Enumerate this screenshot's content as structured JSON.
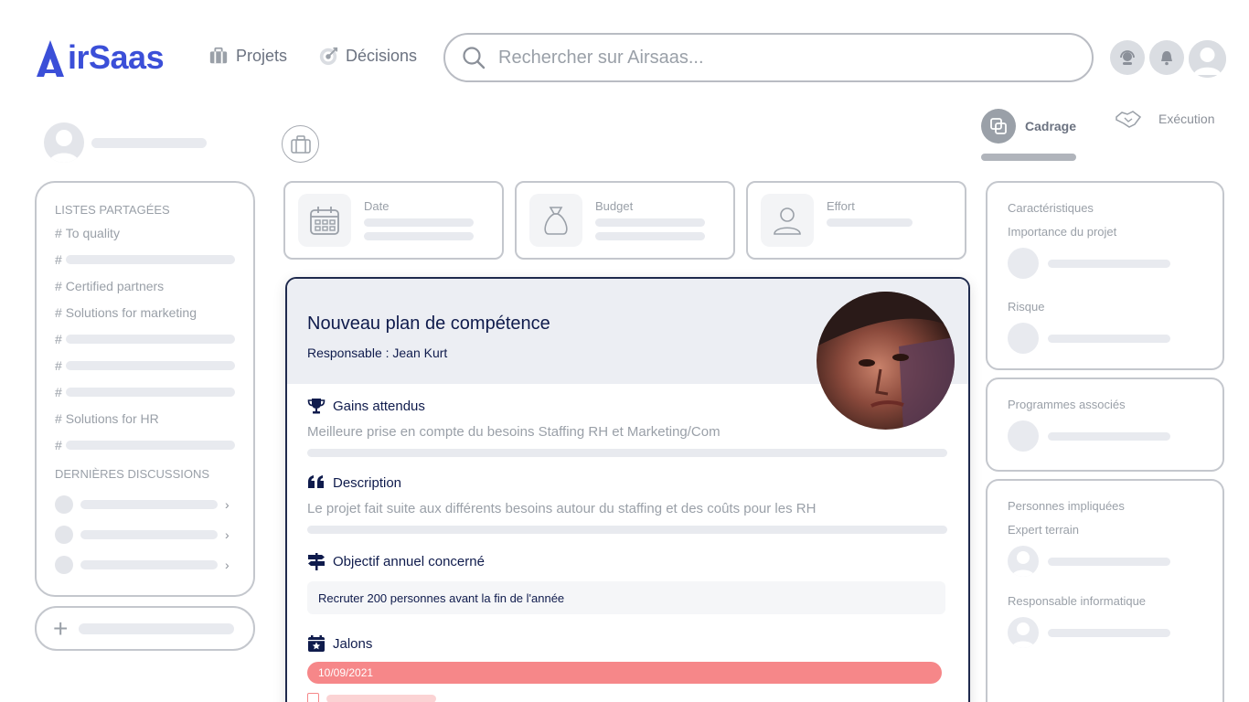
{
  "app": {
    "logo_text": "irSaas",
    "brand_color": "#3b4fd8"
  },
  "nav": {
    "projets": {
      "label": "Projets",
      "icon": "briefcase-icon"
    },
    "decisions": {
      "label": "Décisions",
      "icon": "target-icon"
    }
  },
  "search": {
    "placeholder": "Rechercher sur Airsaas..."
  },
  "sidebar": {
    "shared_lists_heading": "LISTES PARTAGÉES",
    "items": [
      {
        "hash": "#",
        "label": "To quality"
      },
      {
        "hash": "#",
        "label": ""
      },
      {
        "hash": "#",
        "label": "Certified partners"
      },
      {
        "hash": "#",
        "label": "Solutions for marketing"
      },
      {
        "hash": "#",
        "label": ""
      },
      {
        "hash": "#",
        "label": ""
      },
      {
        "hash": "#",
        "label": ""
      },
      {
        "hash": "#",
        "label": "Solutions for HR"
      },
      {
        "hash": "#",
        "label": ""
      }
    ],
    "discussions_heading": "DERNIÈRES DISCUSSIONS",
    "add_button": "+"
  },
  "metrics": {
    "date": "Date",
    "budget": "Budget",
    "effort": "Effort"
  },
  "project": {
    "title": "Nouveau plan de compétence",
    "responsable": "Responsable : Jean Kurt",
    "gains_title": "Gains attendus",
    "gains_text": "Meilleure prise en compte du besoins Staffing RH et Marketing/Com",
    "description_title": "Description",
    "description_text": "Le projet fait suite aux différents besoins autour du staffing et des coûts pour les RH",
    "objective_title": "Objectif annuel concerné",
    "objective_text": "Recruter 200 personnes avant la fin de l'année",
    "milestones_title": "Jalons",
    "milestone_date": "10/09/2021",
    "milestone_color": "#f68789"
  },
  "tabs": {
    "cadrage": "Cadrage",
    "execution": "Exécution"
  },
  "right": {
    "caracteristiques": "Caractéristiques",
    "importance": "Importance du projet",
    "risque": "Risque",
    "programmes": "Programmes associés",
    "personnes": "Personnes impliquées",
    "expert": "Expert terrain",
    "responsable_info": "Responsable informatique"
  }
}
